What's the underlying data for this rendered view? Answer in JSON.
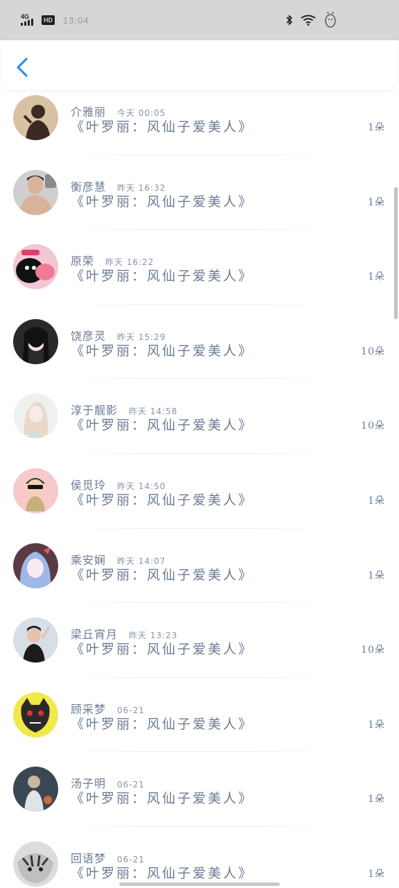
{
  "status_bar": {
    "network": "4G",
    "hd": "HD",
    "time": "13:04"
  },
  "colors": {
    "accent": "#2f8fe6",
    "text": "#6b7a93",
    "status_bar_bg": "#d6d6d6"
  },
  "header": {
    "back_icon": "chevron-left-icon"
  },
  "items": [
    {
      "name": "介雅丽",
      "date": "今天 00:05",
      "title": "《叶罗丽：风仙子爱美人》",
      "count": "1朵"
    },
    {
      "name": "衡彦慧",
      "date": "昨天 16:32",
      "title": "《叶罗丽：风仙子爱美人》",
      "count": "1朵"
    },
    {
      "name": "原荣",
      "date": "昨天 16:22",
      "title": "《叶罗丽：风仙子爱美人》",
      "count": "1朵"
    },
    {
      "name": "饶彦灵",
      "date": "昨天 15:29",
      "title": "《叶罗丽：风仙子爱美人》",
      "count": "10朵"
    },
    {
      "name": "淳于靓影",
      "date": "昨天 14:58",
      "title": "《叶罗丽：风仙子爱美人》",
      "count": "10朵"
    },
    {
      "name": "侯觅玲",
      "date": "昨天 14:50",
      "title": "《叶罗丽：风仙子爱美人》",
      "count": "1朵"
    },
    {
      "name": "乘安娴",
      "date": "昨天 14:07",
      "title": "《叶罗丽：风仙子爱美人》",
      "count": "1朵"
    },
    {
      "name": "梁丘宵月",
      "date": "昨天 13:23",
      "title": "《叶罗丽：风仙子爱美人》",
      "count": "10朵"
    },
    {
      "name": "顾采梦",
      "date": "06-21",
      "title": "《叶罗丽：风仙子爱美人》",
      "count": "1朵"
    },
    {
      "name": "汤子明",
      "date": "06-21",
      "title": "《叶罗丽：风仙子爱美人》",
      "count": "1朵"
    },
    {
      "name": "回语梦",
      "date": "06-21",
      "title": "《叶罗丽：风仙子爱美人》",
      "count": "1朵"
    }
  ]
}
